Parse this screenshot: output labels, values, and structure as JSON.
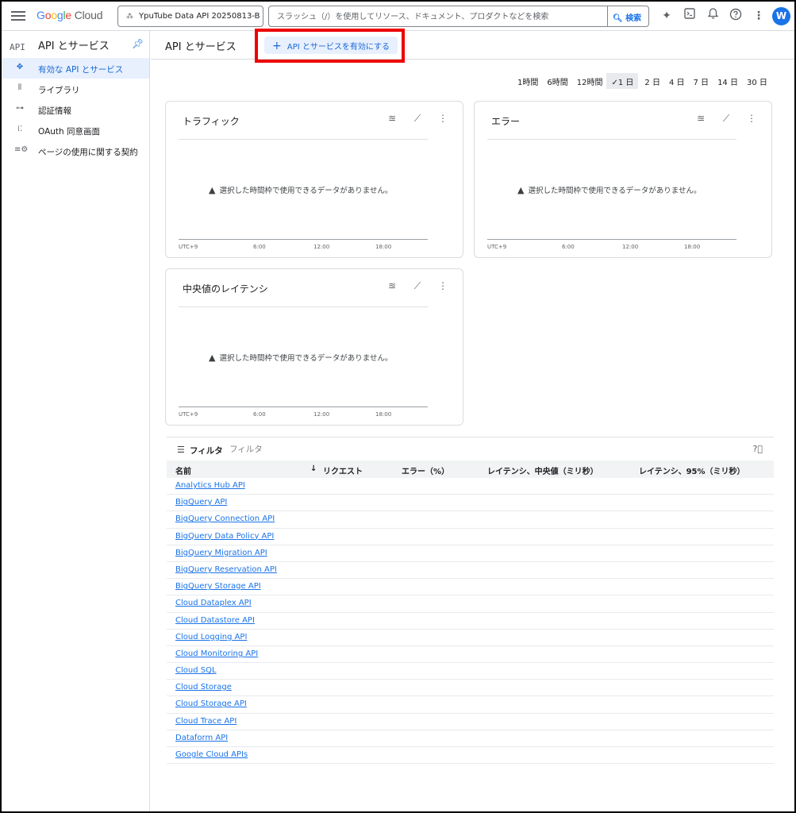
{
  "topbar": {
    "logo_google": [
      "G",
      "o",
      "o",
      "g",
      "l",
      "e"
    ],
    "logo_cloud": "Cloud",
    "project": "YpuTube Data API 20250813-B",
    "search_placeholder": "スラッシュ（/）を使用してリソース、ドキュメント、プロダクトなどを検索",
    "search_button": "検索",
    "avatar_letter": "W"
  },
  "sidebar": {
    "logo": "API",
    "title": "API とサービス",
    "items": [
      {
        "label": "有効な API とサービス",
        "icon": "apis-icon",
        "active": true
      },
      {
        "label": "ライブラリ",
        "icon": "library-icon",
        "active": false
      },
      {
        "label": "認証情報",
        "icon": "key-icon",
        "active": false
      },
      {
        "label": "OAuth 同意画面",
        "icon": "consent-icon",
        "active": false
      },
      {
        "label": "ページの使用に関する契約",
        "icon": "agreement-icon",
        "active": false
      }
    ]
  },
  "main": {
    "title": "API とサービス",
    "enable_button": "API とサービスを有効にする"
  },
  "time_ranges": [
    {
      "label": "1時間",
      "selected": false
    },
    {
      "label": "6時間",
      "selected": false
    },
    {
      "label": "12時間",
      "selected": false
    },
    {
      "label": "1 日",
      "selected": true
    },
    {
      "label": "2 日",
      "selected": false
    },
    {
      "label": "4 日",
      "selected": false
    },
    {
      "label": "7 日",
      "selected": false
    },
    {
      "label": "14 日",
      "selected": false
    },
    {
      "label": "30 日",
      "selected": false
    }
  ],
  "charts": [
    {
      "title": "トラフィック",
      "no_data": "選択した時間枠で使用できるデータがありません。",
      "ticks": [
        "UTC+9",
        "6:00",
        "12:00",
        "18:00"
      ]
    },
    {
      "title": "エラー",
      "no_data": "選択した時間枠で使用できるデータがありません。",
      "ticks": [
        "UTC+9",
        "6:00",
        "12:00",
        "18:00"
      ]
    },
    {
      "title": "中央値のレイテンシ",
      "no_data": "選択した時間枠で使用できるデータがありません。",
      "ticks": [
        "UTC+9",
        "6:00",
        "12:00",
        "18:00"
      ]
    }
  ],
  "table": {
    "filter_label": "フィルタ",
    "filter_placeholder": "フィルタ",
    "columns": [
      "名前",
      "リクエスト",
      "エラー（%）",
      "レイテンシ、中央値（ミリ秒）",
      "レイテンシ、95%（ミリ秒）"
    ],
    "sort_icon": "↓",
    "rows": [
      "Analytics Hub API",
      "BigQuery API",
      "BigQuery Connection API",
      "BigQuery Data Policy API",
      "BigQuery Migration API",
      "BigQuery Reservation API",
      "BigQuery Storage API",
      "Cloud Dataplex API",
      "Cloud Datastore API",
      "Cloud Logging API",
      "Cloud Monitoring API",
      "Cloud SQL",
      "Cloud Storage",
      "Cloud Storage API",
      "Cloud Trace API",
      "Dataform API",
      "Google Cloud APIs"
    ]
  }
}
